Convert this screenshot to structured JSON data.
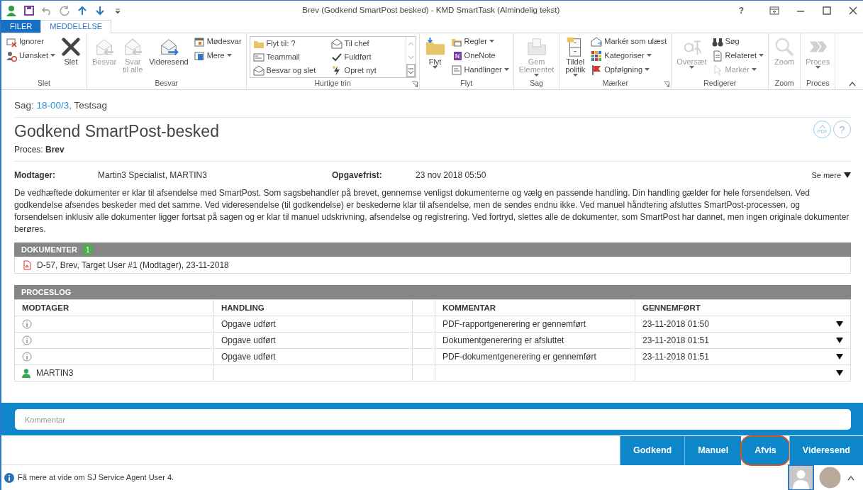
{
  "window": {
    "title": "Brev (Godkend SmartPost besked) - KMD SmartTask (Almindelig tekst)",
    "help": "?"
  },
  "tabs": [
    {
      "label": "FILER",
      "kind": "file",
      "selected": false
    },
    {
      "label": "MEDDELELSE",
      "kind": "tab",
      "selected": true
    }
  ],
  "ribbon": {
    "groups": [
      {
        "label": "Slet",
        "launcher": false,
        "items": [
          {
            "kind": "small",
            "label": "Ignorer",
            "disabled": false,
            "dropdown": false
          },
          {
            "kind": "small",
            "label": "Uønsket",
            "disabled": false,
            "dropdown": true
          },
          {
            "kind": "large",
            "label": "Slet",
            "disabled": false,
            "dropdown": false
          }
        ]
      },
      {
        "label": "Besvar",
        "launcher": false,
        "items": [
          {
            "kind": "large",
            "label": "Besvar",
            "disabled": true,
            "dropdown": false
          },
          {
            "kind": "large",
            "label": "Svar\ntil alle",
            "disabled": true,
            "dropdown": false
          },
          {
            "kind": "large",
            "label": "Videresend",
            "disabled": false,
            "dropdown": false
          },
          {
            "kind": "small",
            "label": "Mødesvar",
            "disabled": false,
            "dropdown": false
          },
          {
            "kind": "small",
            "label": "Mere",
            "disabled": false,
            "dropdown": true
          }
        ]
      },
      {
        "label": "Hurtige trin",
        "launcher": true,
        "items": [
          {
            "kind": "gallery",
            "label": "Flyt til: ?",
            "disabled": false,
            "dropdown": false
          },
          {
            "kind": "gallery",
            "label": "Til chef",
            "disabled": false,
            "dropdown": false
          },
          {
            "kind": "gallery",
            "label": "Teammail",
            "disabled": false,
            "dropdown": false
          },
          {
            "kind": "gallery",
            "label": "Fuldført",
            "disabled": false,
            "dropdown": false
          },
          {
            "kind": "gallery",
            "label": "Besvar og slet",
            "disabled": false,
            "dropdown": false
          },
          {
            "kind": "gallery",
            "label": "Opret nyt",
            "disabled": false,
            "dropdown": false
          }
        ]
      },
      {
        "label": "Flyt",
        "launcher": false,
        "items": [
          {
            "kind": "large",
            "label": "Flyt",
            "disabled": false,
            "dropdown": true
          },
          {
            "kind": "small",
            "label": "Regler",
            "disabled": false,
            "dropdown": true
          },
          {
            "kind": "small",
            "label": "OneNote",
            "disabled": false,
            "dropdown": false
          },
          {
            "kind": "small",
            "label": "Handlinger",
            "disabled": false,
            "dropdown": true
          }
        ]
      },
      {
        "label": "Sag",
        "launcher": false,
        "items": [
          {
            "kind": "large",
            "label": "Gem\nElementet",
            "disabled": true,
            "dropdown": true
          }
        ]
      },
      {
        "label": "Mærker",
        "launcher": true,
        "items": [
          {
            "kind": "large",
            "label": "Tildel\npolitik",
            "disabled": false,
            "dropdown": true
          },
          {
            "kind": "small",
            "label": "Markér som ulæst",
            "disabled": false,
            "dropdown": false
          },
          {
            "kind": "small",
            "label": "Kategoriser",
            "disabled": false,
            "dropdown": true
          },
          {
            "kind": "small",
            "label": "Opfølgning",
            "disabled": false,
            "dropdown": true
          }
        ]
      },
      {
        "label": "Redigerer",
        "launcher": false,
        "items": [
          {
            "kind": "large",
            "label": "Oversæt",
            "disabled": true,
            "dropdown": true
          },
          {
            "kind": "small",
            "label": "Søg",
            "disabled": false,
            "dropdown": false
          },
          {
            "kind": "small",
            "label": "Relateret",
            "disabled": false,
            "dropdown": true
          },
          {
            "kind": "small",
            "label": "Markér",
            "disabled": true,
            "dropdown": true
          }
        ]
      },
      {
        "label": "Zoom",
        "launcher": false,
        "items": [
          {
            "kind": "large",
            "label": "Zoom",
            "disabled": true,
            "dropdown": false
          }
        ]
      },
      {
        "label": "Proces",
        "launcher": false,
        "items": [
          {
            "kind": "large",
            "label": "Proces",
            "disabled": true,
            "dropdown": true
          }
        ]
      }
    ]
  },
  "case": {
    "label": "Sag:",
    "link": "18-00/3,",
    "name": "Testsag"
  },
  "heading": "Godkend SmartPost-besked",
  "pdf_button": "PDF",
  "help_button": "?",
  "process": {
    "label": "Proces:",
    "value": "Brev"
  },
  "fields": [
    {
      "label": "Modtager:",
      "value": "Martin3 Specialist, MARTIN3"
    },
    {
      "label": "Opgavefrist:",
      "value": "23 nov 2018 05:50"
    }
  ],
  "see_more": "Se mere",
  "description": "De vedhæftede dokumenter er klar til afsendelse med SmartPost. Som sagsbehandler på brevet, gennemse venligst dokumenterne og vælg en passende handling. Din handling gælder for hele forsendelsen. Ved godkendelse afsendes beskeder med det samme. Ved videresendelse (til godkendelse) er beskederne klar til afsendelse, men de sendes endnu ikke. Ved manuel håndtering afsluttes SmartPost-processen, og forsendelsen inklusiv alle dokumenter ligger fortsat på sagen og er klar til manuel udskrivning, afsendelse og registrering. Ved fortryd, slettes alle de dokumenter, som SmartPost har dannet, men ingen originale dokumenter berøres.",
  "documents": {
    "title": "DOKUMENTER",
    "count": "1",
    "items": [
      "D-57, Brev, Target User #1 (Modtager), 23-11-2018"
    ]
  },
  "process_log": {
    "title": "PROCESLOG",
    "columns": [
      "MODTAGER",
      "HANDLING",
      "KOMMENTAR",
      "GENNEMFØRT"
    ],
    "rows": [
      {
        "kind": "info",
        "recipient": "",
        "action": "Opgave udført",
        "comment": "PDF-rapportgenerering er gennemført",
        "done": "23-11-2018 01:50"
      },
      {
        "kind": "info",
        "recipient": "",
        "action": "Opgave udført",
        "comment": "Dokumentgenerering er afsluttet",
        "done": "23-11-2018 01:51"
      },
      {
        "kind": "info",
        "recipient": "",
        "action": "Opgave udført",
        "comment": "PDF-dokumentgenerering er gennemført",
        "done": "23-11-2018 01:51"
      },
      {
        "kind": "user",
        "recipient": "MARTIN3",
        "action": "",
        "comment": "",
        "done": ""
      }
    ]
  },
  "comment": {
    "placeholder": "Kommentar"
  },
  "actions": [
    {
      "label": "Godkend",
      "highlighted": false
    },
    {
      "label": "Manuel",
      "highlighted": false
    },
    {
      "label": "Afvis",
      "highlighted": true
    },
    {
      "label": "Videresend",
      "highlighted": false
    }
  ],
  "status_bar": {
    "text": "Få mere at vide om SJ Service Agent User 4.",
    "people": [
      {
        "kind": "silhouette",
        "selected": true
      },
      {
        "kind": "photo",
        "selected": false
      }
    ]
  }
}
